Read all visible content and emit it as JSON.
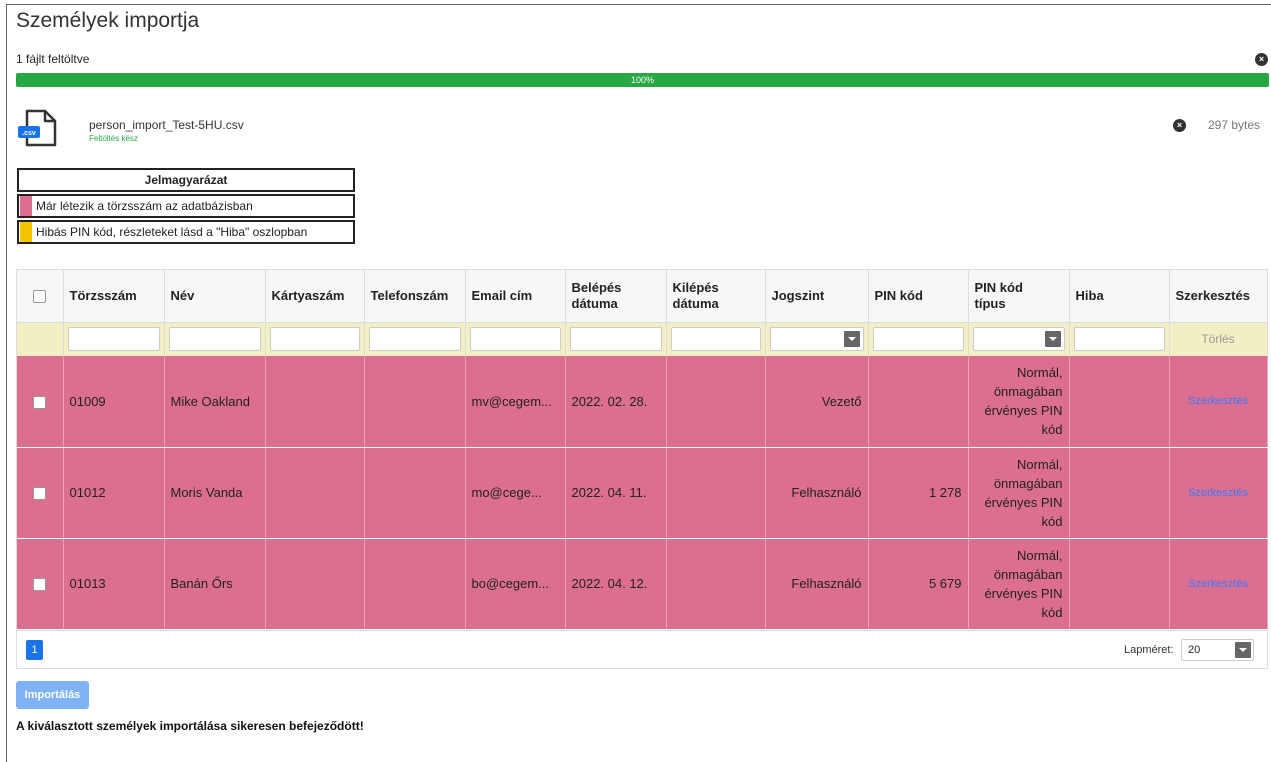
{
  "page": {
    "title": "Személyek importja",
    "upload_count": "1 fájlt feltöltve",
    "progress_text": "100%",
    "progress_value": 1.0
  },
  "file": {
    "icon": "csv-file-icon",
    "icon_label": ".csv",
    "name": "person_import_Test-5HU.csv",
    "status": "Feltöltés kész",
    "size": "297 bytes"
  },
  "legend": {
    "title": "Jelmagyarázat",
    "items": [
      {
        "color": "#dc6f90",
        "label": "Már létezik a törzsszám az adatbázisban"
      },
      {
        "color": "#f5c400",
        "label": "Hibás PIN kód, részleteket lásd a \"Hiba\" oszlopban"
      }
    ]
  },
  "grid": {
    "columns": [
      {
        "line1": "Törzsszám",
        "line2": ""
      },
      {
        "line1": "Név",
        "line2": ""
      },
      {
        "line1": "Kártyaszám",
        "line2": ""
      },
      {
        "line1": "Telefonszám",
        "line2": ""
      },
      {
        "line1": "Email cím",
        "line2": ""
      },
      {
        "line1": "Belépés",
        "line2": "dátuma"
      },
      {
        "line1": "Kilépés",
        "line2": "dátuma"
      },
      {
        "line1": "Jogszint",
        "line2": ""
      },
      {
        "line1": "PIN kód",
        "line2": ""
      },
      {
        "line1": "PIN kód",
        "line2": "típus"
      },
      {
        "line1": "Hiba",
        "line2": ""
      },
      {
        "line1": "Szerkesztés",
        "line2": ""
      }
    ],
    "filter_clear_label": "Törlés",
    "rows": [
      {
        "id": "01009",
        "name": "Mike Oakland",
        "card": "",
        "phone": "",
        "email": "mv@cegem...",
        "entry": "2022. 02. 28.",
        "exit": "",
        "role": "Vezető",
        "pin": "",
        "pin_type": "Normál, önmagában érvényes PIN kód",
        "error": "",
        "edit": "Szerkesztés"
      },
      {
        "id": "01012",
        "name": "Moris Vanda",
        "card": "",
        "phone": "",
        "email": "mo@cege...",
        "entry": "2022. 04. 11.",
        "exit": "",
        "role": "Felhasználó",
        "pin": "1 278",
        "pin_type": "Normál, önmagában érvényes PIN kód",
        "error": "",
        "edit": "Szerkesztés"
      },
      {
        "id": "01013",
        "name": "Banán Őrs",
        "card": "",
        "phone": "",
        "email": "bo@cegem...",
        "entry": "2022. 04. 12.",
        "exit": "",
        "role": "Felhasználó",
        "pin": "5 679",
        "pin_type": "Normál, önmagában érvényes PIN kód",
        "error": "",
        "edit": "Szerkesztés"
      }
    ],
    "pager": {
      "current_page": "1",
      "page_size_label": "Lapméret:",
      "page_size": "20"
    }
  },
  "actions": {
    "import_label": "Importálás"
  },
  "message": "A kiválasztott személyek importálása sikeresen befejeződött!",
  "colors": {
    "row_exists": "#dc6f90",
    "pin_error": "#f5c400",
    "progress": "#28a745",
    "accent": "#1a73e8"
  }
}
